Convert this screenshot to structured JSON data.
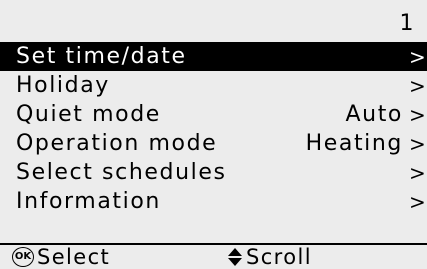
{
  "header": {
    "page_number": "1"
  },
  "menu": {
    "items": [
      {
        "label": "Set time/date",
        "value": "",
        "arrow": ">",
        "selected": true
      },
      {
        "label": "Holiday",
        "value": "",
        "arrow": ">",
        "selected": false
      },
      {
        "label": "Quiet mode",
        "value": "Auto",
        "arrow": ">",
        "selected": false
      },
      {
        "label": "Operation mode",
        "value": "Heating",
        "arrow": ">",
        "selected": false
      },
      {
        "label": "Select schedules",
        "value": "",
        "arrow": ">",
        "selected": false
      },
      {
        "label": "Information",
        "value": "",
        "arrow": ">",
        "selected": false
      }
    ]
  },
  "footer": {
    "ok_icon_text": "OK",
    "select_label": "Select",
    "scroll_label": "Scroll"
  },
  "colors": {
    "screen_background": "#ececec",
    "selected_background": "#000000",
    "selected_text": "#ffffff",
    "text": "#000000"
  },
  "icons": {
    "ok": "ok-button-icon",
    "scroll": "up-down-arrow-icon",
    "arrow": "chevron-right-icon"
  }
}
